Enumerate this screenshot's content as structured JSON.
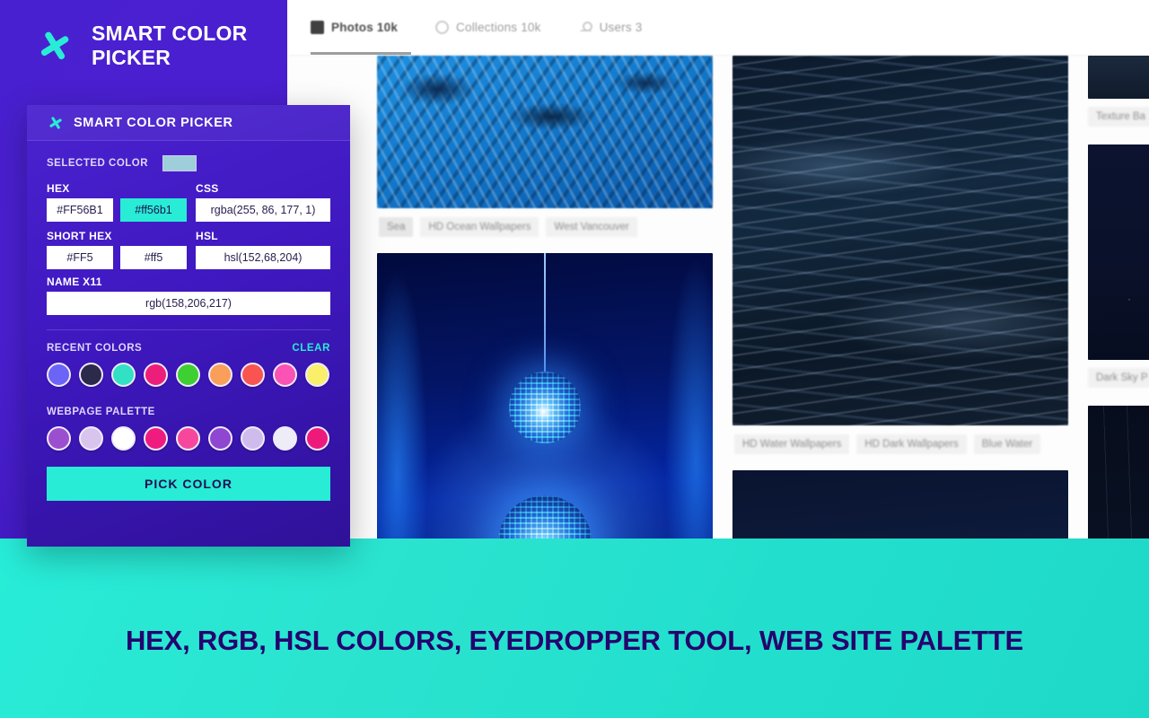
{
  "brand": {
    "title": "SMART COLOR PICKER",
    "logo_icon": "eyedropper-icon",
    "accent": "#28ecd6",
    "purple": "#4920cf"
  },
  "banner": {
    "text": "HEX, RGB, HSL COLORS, EYEDROPPER TOOL, WEB SITE PALETTE",
    "text_color": "#25046e",
    "background": "#28ecd6"
  },
  "browser": {
    "tabs": [
      {
        "label": "Photos 10k",
        "icon": "photo-icon",
        "active": true
      },
      {
        "label": "Collections 10k",
        "icon": "collections-icon",
        "active": false
      },
      {
        "label": "Users 3",
        "icon": "user-icon",
        "active": false
      }
    ],
    "cards": [
      {
        "photo": "ocean-bright",
        "tags": [
          "Sea",
          "HD Ocean Wallpapers",
          "West Vancouver"
        ]
      },
      {
        "photo": "disco-balls-blue",
        "tags": []
      },
      {
        "photo": "dark-waves",
        "tags": [
          "HD Water Wallpapers",
          "HD Dark Wallpapers",
          "Blue Water"
        ]
      },
      {
        "photo": "dark-blue-block",
        "tags": []
      }
    ],
    "side_cards": [
      {
        "photo": "texture-strip",
        "tag": "Texture Ba"
      },
      {
        "photo": "night-sky",
        "tag": "Dark Sky P"
      },
      {
        "photo": "dark-streaks",
        "tag": ""
      }
    ]
  },
  "panel": {
    "header_title": "SMART COLOR PICKER",
    "header_icon": "eyedropper-icon",
    "selected_color_label": "SELECTED COLOR",
    "selected_color_value": "#9eced9",
    "fields": {
      "hex_label": "HEX",
      "hex_upper": "#FF56B1",
      "hex_lower": "#ff56b1",
      "css_label": "CSS",
      "css_value": "rgba(255, 86, 177, 1)",
      "short_hex_label": "SHORT HEX",
      "short_hex_upper": "#FF5",
      "short_hex_lower": "#ff5",
      "hsl_label": "HSL",
      "hsl_value": "hsl(152,68,204)",
      "name_label": "NAME X11",
      "name_value": "rgb(158,206,217)"
    },
    "recent": {
      "label": "RECENT COLORS",
      "clear_label": "CLEAR",
      "colors": [
        "#6c63f7",
        "#2c2a4a",
        "#32e0c4",
        "#ed1e79",
        "#3ecf32",
        "#f99f59",
        "#fa5450",
        "#fa52b5",
        "#f9ef6b"
      ]
    },
    "palette": {
      "label": "WEBPAGE PALETTE",
      "colors": [
        "#9b4fce",
        "#d9c4ee",
        "#ffffff",
        "#f01b7f",
        "#f7479c",
        "#8f46d0",
        "#cfbcec",
        "#eeecf7",
        "#ed1a7c"
      ]
    },
    "pick_button_label": "PICK COLOR"
  }
}
